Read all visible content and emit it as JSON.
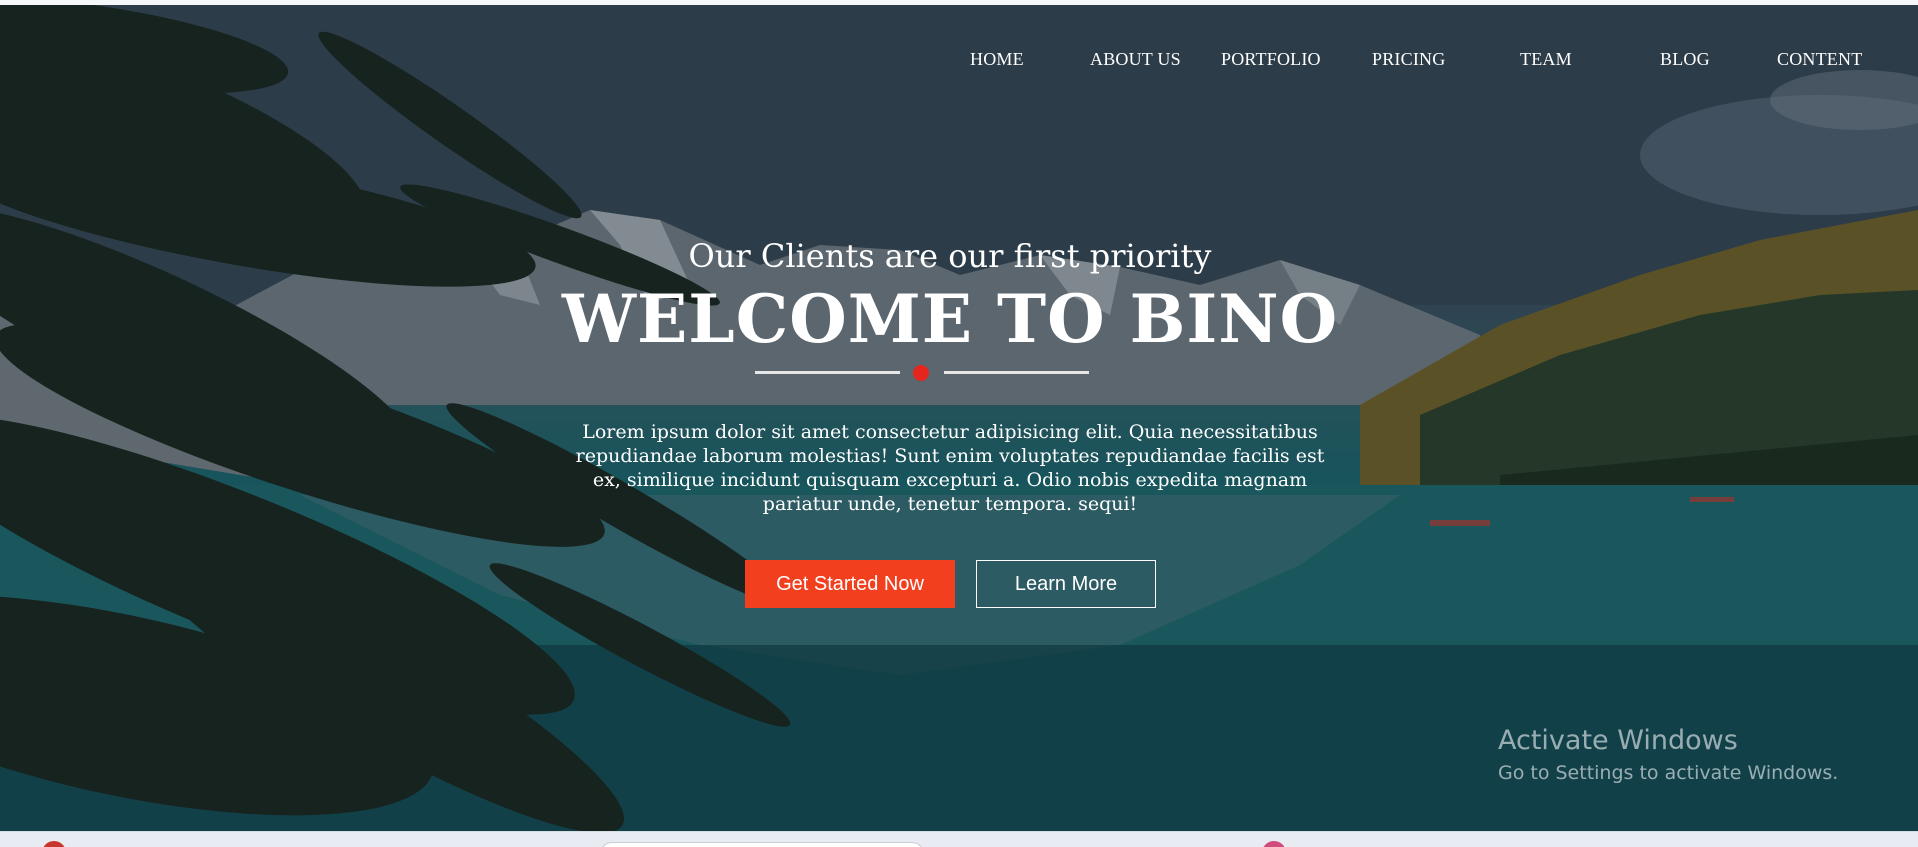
{
  "nav": {
    "items": [
      {
        "label": "HOME"
      },
      {
        "label": "ABOUT US"
      },
      {
        "label": "PORTFOLIO"
      },
      {
        "label": "PRICING"
      },
      {
        "label": "TEAM"
      },
      {
        "label": "BLOG"
      },
      {
        "label": "CONTENT"
      }
    ]
  },
  "hero": {
    "tagline": "Our Clients are our first priority",
    "headline": "WELCOME TO BINO",
    "description": "Lorem ipsum dolor sit amet consectetur adipisicing elit. Quia necessitatibus repudiandae laborum molestias! Sunt enim voluptates repudiandae facilis est ex, similique incidunt quisquam excepturi a. Odio nobis expedita magnam pariatur unde, tenetur tempora. sequi!",
    "primary_button": "Get Started Now",
    "secondary_button": "Learn More"
  },
  "watermark": {
    "title": "Activate Windows",
    "subtitle": "Go to Settings to activate Windows."
  },
  "colors": {
    "accent": "#f2401f",
    "divider_dot": "#e5261e",
    "text": "#ffffff"
  },
  "background": {
    "icon": "mountain-lake-photo"
  }
}
